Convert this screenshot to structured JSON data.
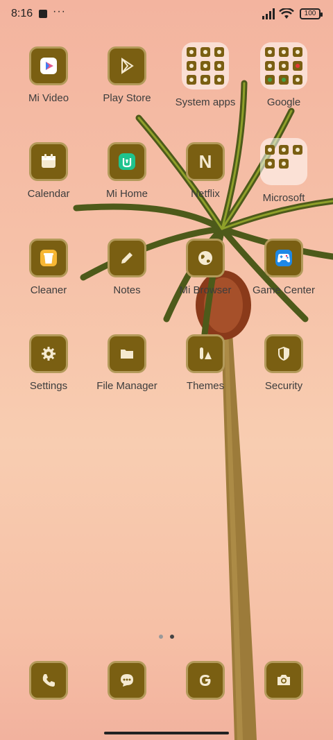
{
  "status_bar": {
    "time": "8:16",
    "battery": "100"
  },
  "grid": {
    "row1": [
      {
        "label": "Mi Video"
      },
      {
        "label": "Play Store"
      },
      {
        "label": "System apps"
      },
      {
        "label": "Google"
      }
    ],
    "row2": [
      {
        "label": "Calendar"
      },
      {
        "label": "Mi Home"
      },
      {
        "label": "Netflix"
      },
      {
        "label": "Microsoft"
      }
    ],
    "row3": [
      {
        "label": "Cleaner"
      },
      {
        "label": "Notes"
      },
      {
        "label": "Mi Browser"
      },
      {
        "label": "Game Center"
      }
    ],
    "row4": [
      {
        "label": "Settings"
      },
      {
        "label": "File Manager"
      },
      {
        "label": "Themes"
      },
      {
        "label": "Security"
      }
    ]
  },
  "netflix_glyph": "N",
  "pages": {
    "count": 2,
    "active": 2
  },
  "colors": {
    "icon_bg": "#7a5f12",
    "icon_border": "#b39a5a",
    "label": "#3d3d3d"
  }
}
